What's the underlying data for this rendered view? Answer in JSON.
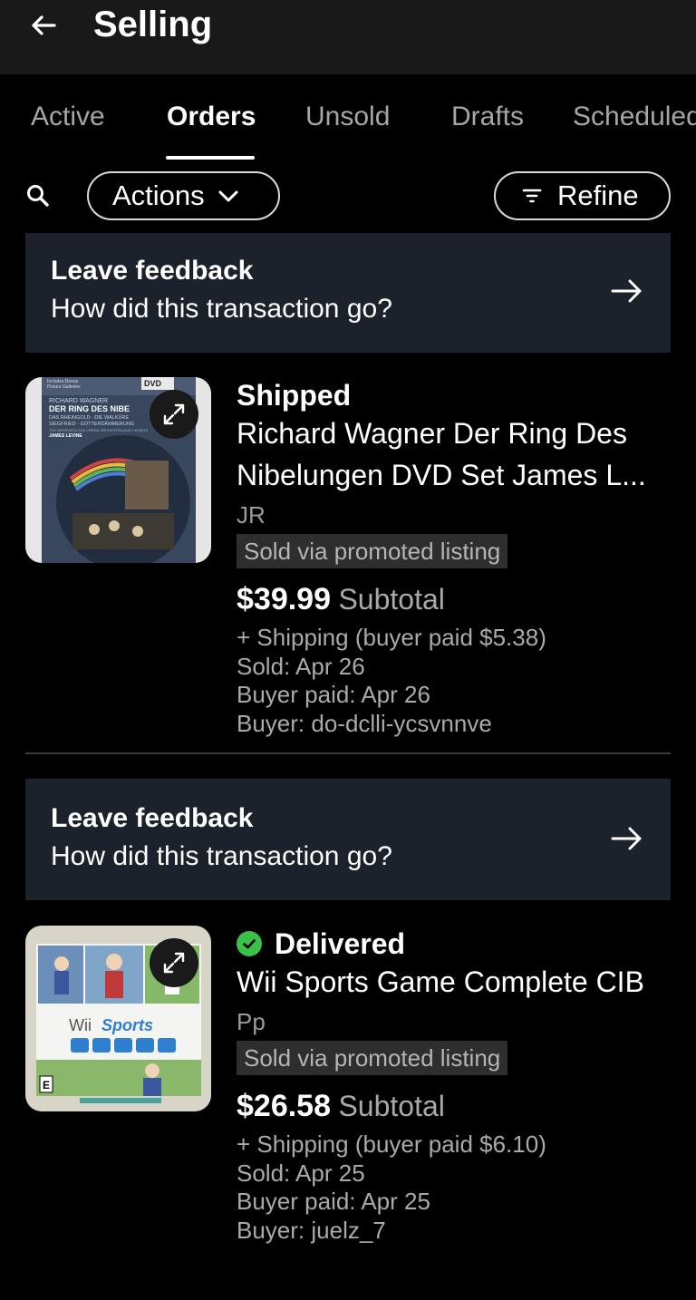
{
  "header": {
    "title": "Selling",
    "back_icon": "arrow-left-icon"
  },
  "tabs": [
    {
      "label": "Active",
      "active": false
    },
    {
      "label": "Orders",
      "active": true
    },
    {
      "label": "Unsold",
      "active": false
    },
    {
      "label": "Drafts",
      "active": false
    },
    {
      "label": "Scheduled",
      "active": false
    }
  ],
  "toolbar": {
    "search_icon": "search-icon",
    "actions_label": "Actions",
    "refine_label": "Refine"
  },
  "orders": [
    {
      "feedback_title": "Leave feedback",
      "feedback_sub": "How did this transaction go?",
      "status": "Shipped",
      "title": "Richard Wagner Der Ring Des Nibelungen DVD Set James L...",
      "seller_note": "JR",
      "promo": "Sold via promoted listing",
      "price": "$39.99",
      "subtotal_label": "Subtotal",
      "shipping": "+ Shipping (buyer paid $5.38)",
      "sold": "Sold: Apr 26",
      "buyer_paid": "Buyer paid: Apr 26",
      "buyer": "Buyer: do-dclli-ycsvnnve",
      "cover_text": [
        "Includes Bonus",
        "Picture Galleries",
        "RICHARD WAGNER",
        "DER RING DES NIBE",
        "DAS RHEINGOLD · DIE WALKÜRE",
        "SIEGFRIED · GÖTTERDÄMMERUNG",
        "THE METROPOLITAN OPERA ORCHESTRA AND CHORUS",
        "JAMES LEVINE",
        "DVD"
      ]
    },
    {
      "feedback_title": "Leave feedback",
      "feedback_sub": "How did this transaction go?",
      "status": "Delivered",
      "title": "Wii Sports Game Complete CIB",
      "seller_note": "Pp",
      "promo": "Sold via promoted listing",
      "price": "$26.58",
      "subtotal_label": "Subtotal",
      "shipping": "+ Shipping (buyer paid $6.10)",
      "sold": "Sold: Apr 25",
      "buyer_paid": "Buyer paid: Apr 25",
      "buyer": "Buyer: juelz_7",
      "cover_text": [
        "Wii",
        "Sports",
        "E"
      ]
    }
  ],
  "colors": {
    "background": "#000000",
    "banner": "#1c222b",
    "delivered": "#3ac14a"
  }
}
